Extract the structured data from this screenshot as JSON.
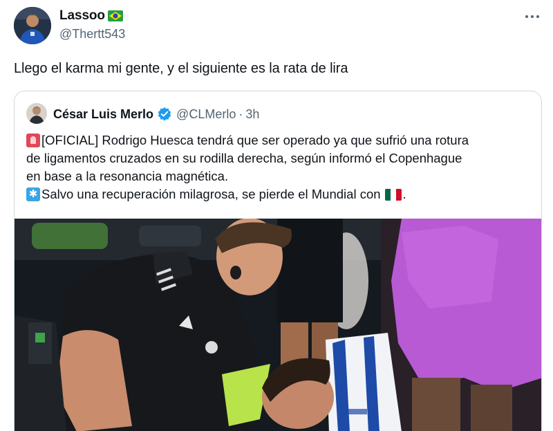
{
  "post": {
    "author_name": "Lassoo",
    "author_handle": "@Thertt543",
    "text": "Llego el karma mi gente, y el siguiente es la rata de lira"
  },
  "quoted": {
    "author_name": "César Luis Merlo",
    "author_handle": "@CLMerlo",
    "separator": "·",
    "time": "3h",
    "lines": [
      "[OFICIAL] Rodrigo Huesca tendrá que ser operado ya que sufrió una rotura",
      "de ligamentos cruzados en su rodilla derecha, según informó el Copenhague",
      "en base a la resonancia magnética.",
      "Salvo una recuperación milagrosa, se pierde el Mundial con",
      "."
    ]
  },
  "icons": {
    "more": "more-options-icon",
    "verified": "verified-badge-icon",
    "flag_author": "brazil-flag-icon",
    "flag_text": "mexico-flag-icon"
  },
  "colors": {
    "text": "#0f1419",
    "secondary": "#536471",
    "border": "#cfd9de",
    "verified": "#1d9bf0"
  }
}
